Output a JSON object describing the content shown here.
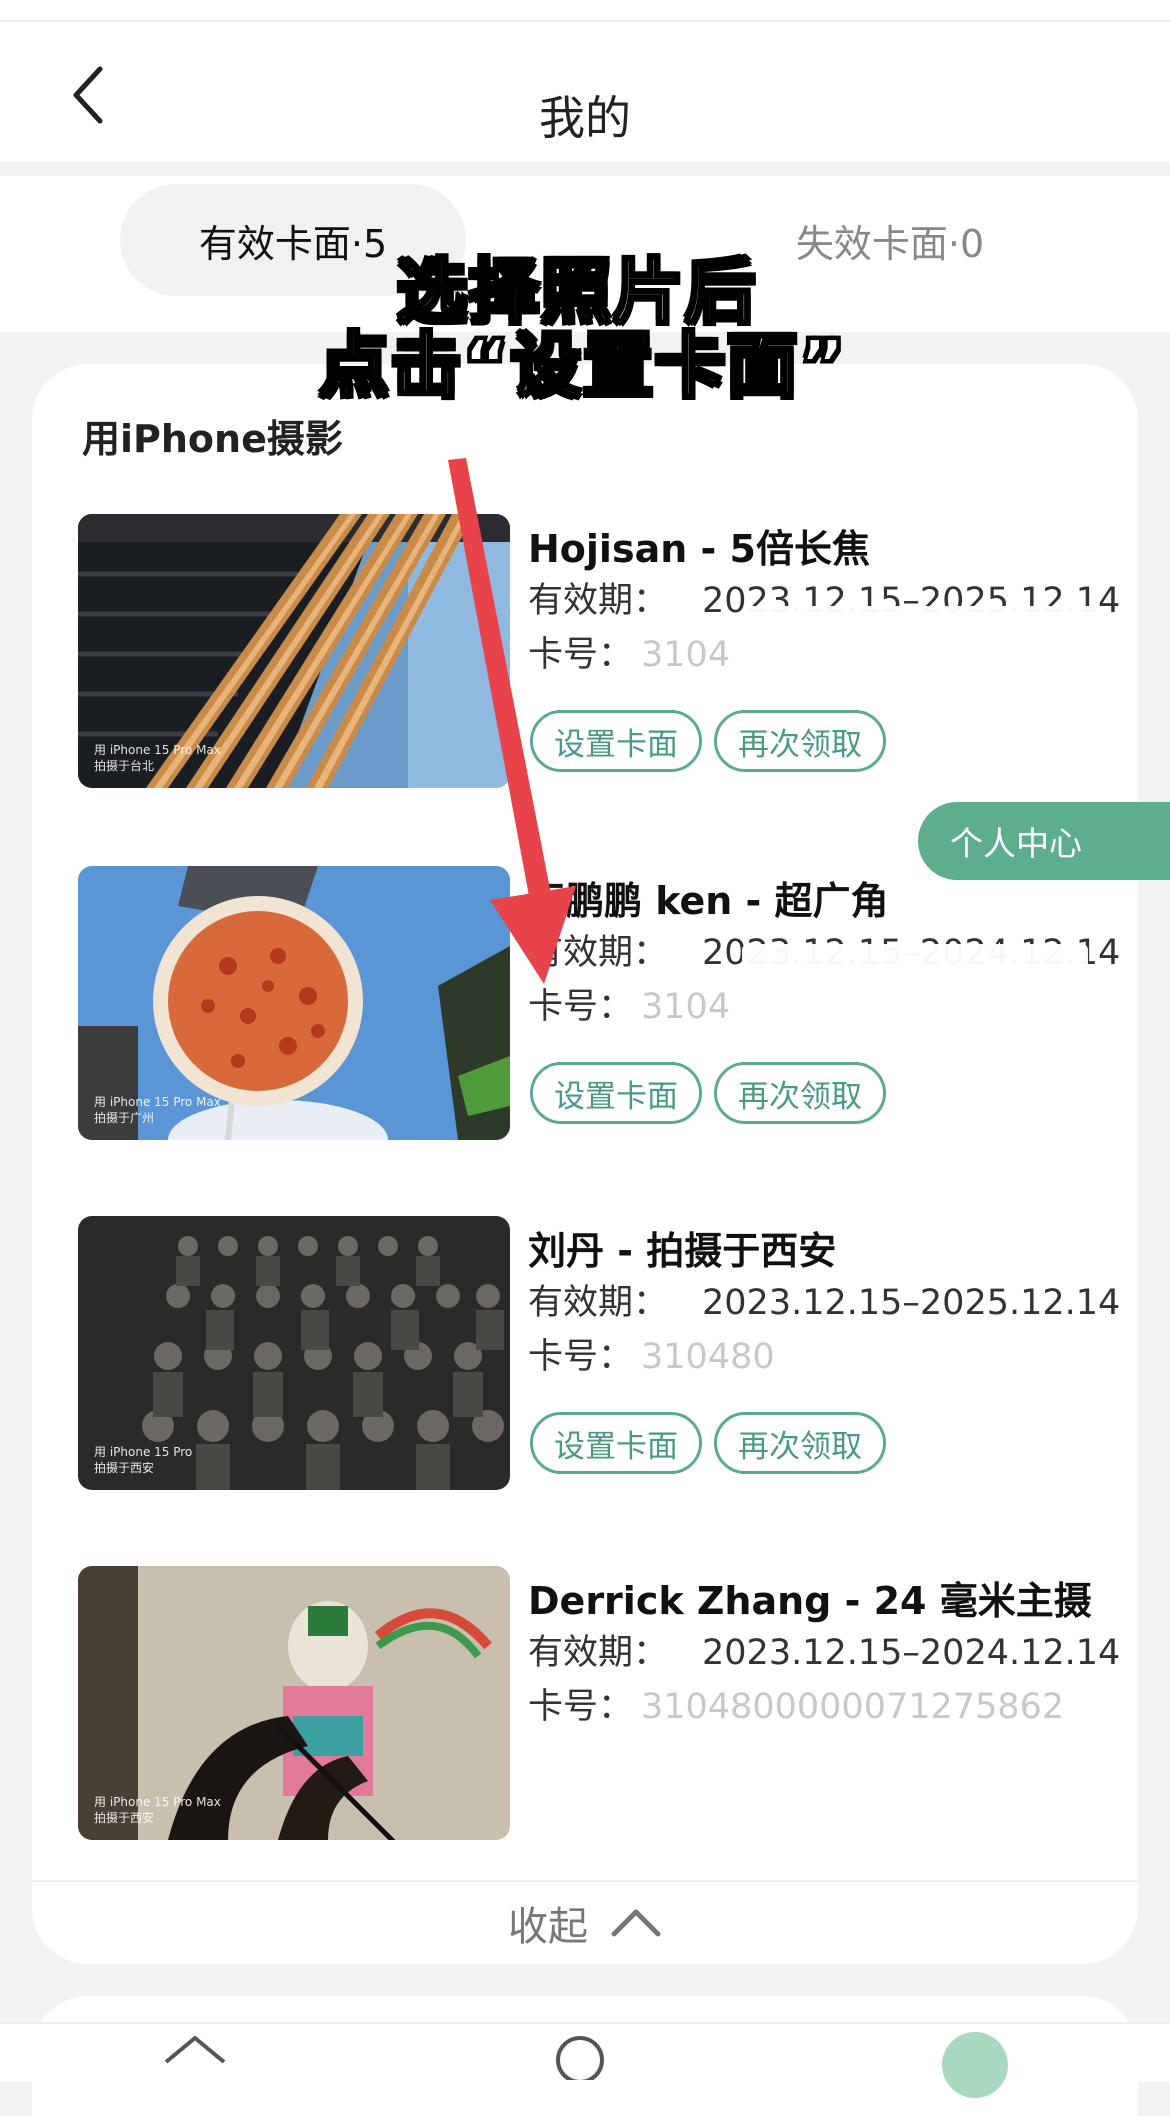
{
  "header": {
    "title": "我的"
  },
  "tabs": {
    "active": "有效卡面·5",
    "inactive": "失效卡面·0"
  },
  "overlay": {
    "line1": "选择照片后",
    "line2": "点击“设置卡面”"
  },
  "section": {
    "title": "用iPhone摄影"
  },
  "labels": {
    "valid": "有效期：",
    "card_no": "卡号：",
    "set_button": "设置卡面",
    "again_button": "再次领取"
  },
  "items": [
    {
      "title": "Hojisan - 5倍长焦",
      "valid": "2023.12.15–2025.12.14",
      "card_no": "3104",
      "photo_caption": "用 iPhone 15 Pro Max\n拍摄于台北"
    },
    {
      "title": "王鹏鹏 ken - 超广角",
      "valid": "2023.12.15–2024.12.14",
      "card_no": "3104",
      "photo_caption": "用 iPhone 15 Pro Max\n拍摄于广州"
    },
    {
      "title": "刘丹 - 拍摄于西安",
      "valid": "2023.12.15–2025.12.14",
      "card_no": "310480",
      "photo_caption": "用 iPhone 15 Pro\n拍摄于西安"
    },
    {
      "title": "Derrick Zhang - 24 毫米主摄",
      "valid": "2023.12.15–2024.12.14",
      "card_no": "3104800000071275862",
      "photo_caption": "用 iPhone 15 Pro Max\n拍摄于西安"
    }
  ],
  "floating": {
    "personal_center": "个人中心"
  },
  "collapse": {
    "label": "收起"
  },
  "colors": {
    "accent": "#5dae8c",
    "annotation_arrow": "#e8434b"
  },
  "icons": {
    "back": "chevron-left-icon",
    "collapse": "chevron-up-icon",
    "home": "home-icon",
    "search": "search-icon"
  }
}
